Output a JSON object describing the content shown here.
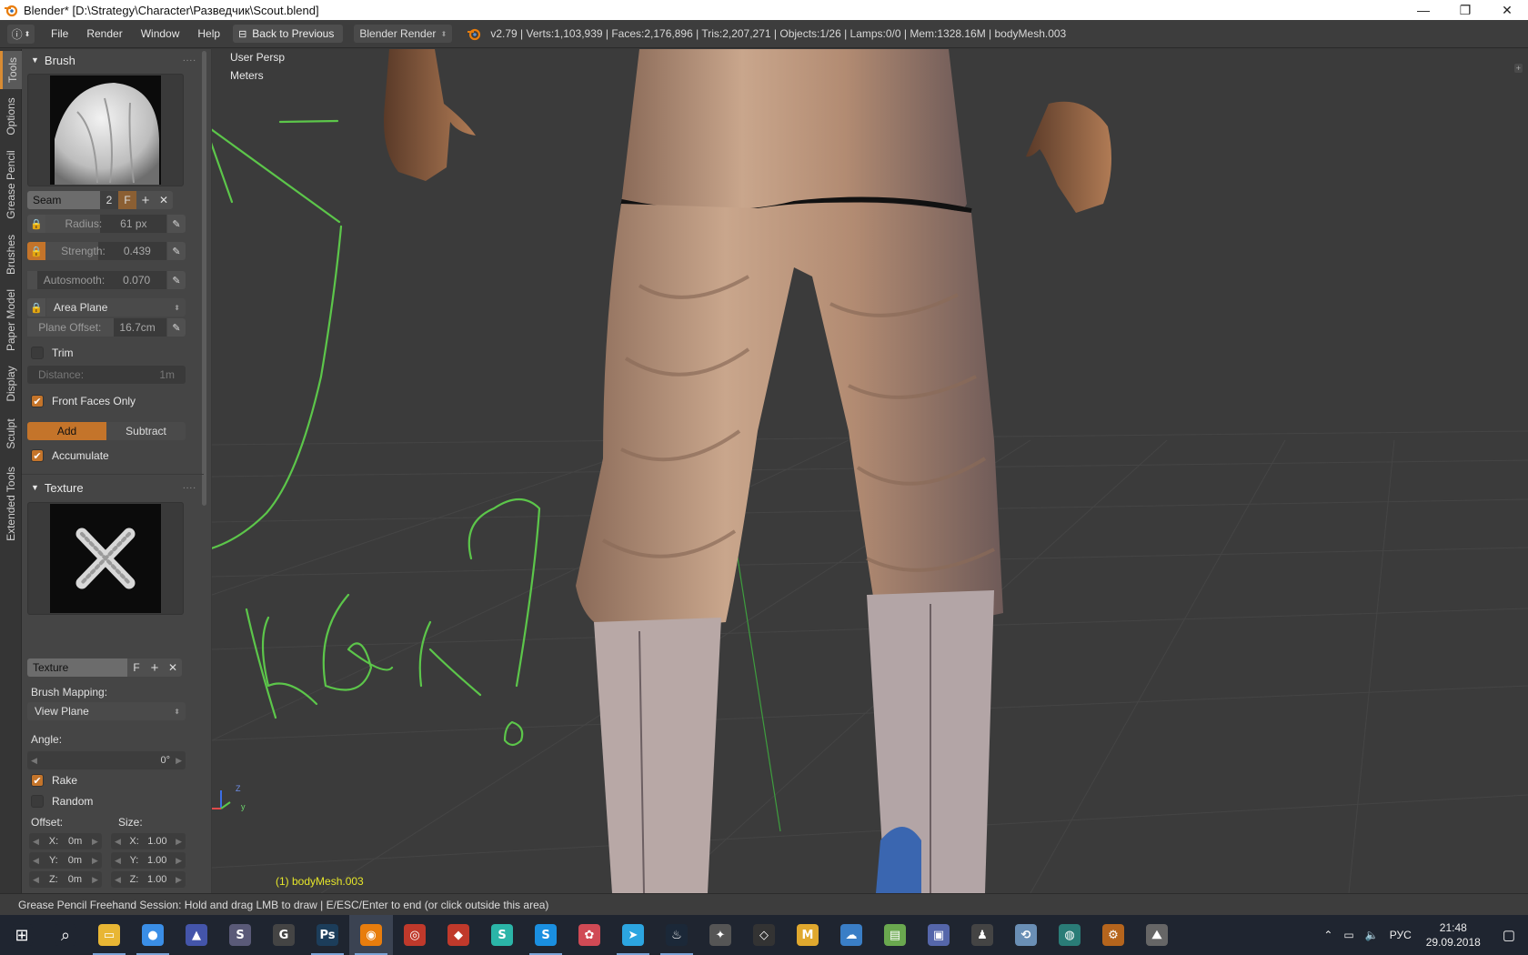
{
  "window": {
    "title": "Blender* [D:\\Strategy\\Character\\Разведчик\\Scout.blend]",
    "minimize_glyph": "—",
    "maximize_glyph": "❐",
    "close_glyph": "✕"
  },
  "header": {
    "menus": [
      "File",
      "Render",
      "Window",
      "Help"
    ],
    "back_button": "Back to Previous",
    "render_engine": "Blender Render",
    "version": "v2.79",
    "stats": "Verts:1,103,939 | Faces:2,176,896 | Tris:2,207,271 | Objects:1/26 | Lamps:0/0 | Mem:1328.16M | bodyMesh.003"
  },
  "tabs": [
    "Tools",
    "Options",
    "Grease Pencil",
    "Brushes",
    "Paper Model",
    "Display",
    "Sculpt",
    "Extended Tools"
  ],
  "brush_panel": {
    "title": "Brush",
    "brush_name": "Seam",
    "users": "2",
    "fake_user": "F",
    "radius_label": "Radius:",
    "radius_value": "61 px",
    "radius_fraction": 0.45,
    "strength_label": "Strength:",
    "strength_value": "0.439",
    "strength_fraction": 0.439,
    "autosmooth_label": "Autosmooth:",
    "autosmooth_value": "0.070",
    "autosmooth_fraction": 0.07,
    "area_mode": "Area Plane",
    "plane_offset_label": "Plane Offset:",
    "plane_offset_value": "16.7cm",
    "plane_offset_fraction": 0.62,
    "trim_label": "Trim",
    "trim_checked": false,
    "distance_label": "Distance:",
    "distance_value": "1m",
    "front_faces_label": "Front Faces Only",
    "front_faces_checked": true,
    "add_label": "Add",
    "subtract_label": "Subtract",
    "accumulate_label": "Accumulate",
    "accumulate_checked": true
  },
  "texture_panel": {
    "title": "Texture",
    "texture_name": "Texture",
    "fake_user": "F",
    "brush_mapping_label": "Brush Mapping:",
    "brush_mapping_value": "View Plane",
    "angle_label": "Angle:",
    "angle_value": "0°",
    "rake_label": "Rake",
    "rake_checked": true,
    "random_label": "Random",
    "random_checked": false,
    "offset_label": "Offset:",
    "size_label": "Size:",
    "offset": [
      {
        "axis": "X:",
        "value": "0m"
      },
      {
        "axis": "Y:",
        "value": "0m"
      },
      {
        "axis": "Z:",
        "value": "0m"
      }
    ],
    "size": [
      {
        "axis": "X:",
        "value": "1.00"
      },
      {
        "axis": "Y:",
        "value": "1.00"
      },
      {
        "axis": "Z:",
        "value": "1.00"
      }
    ]
  },
  "viewport": {
    "view_name": "User Persp",
    "units": "Meters",
    "object_label": "(1) bodyMesh.003",
    "axis_z": "Z",
    "axis_y": "y",
    "annotation_color": "#5cc64a"
  },
  "status": {
    "text": "Grease Pencil Freehand Session: Hold and drag LMB to draw | E/ESC/Enter to end  (or click outside this area)"
  },
  "taskbar": {
    "apps": [
      {
        "name": "start",
        "glyph": "⊞",
        "color": "#1f2530"
      },
      {
        "name": "search",
        "glyph": "⌕",
        "color": "#1f2530"
      },
      {
        "name": "file-explorer",
        "glyph": "▭",
        "color": "#e8b634"
      },
      {
        "name": "chrome",
        "glyph": "●",
        "color": "#3a8ee6"
      },
      {
        "name": "app-4",
        "glyph": "▲",
        "color": "#4455aa"
      },
      {
        "name": "app-5",
        "glyph": "S",
        "color": "#5a5a78"
      },
      {
        "name": "gzdb",
        "glyph": "G",
        "color": "#444444"
      },
      {
        "name": "photoshop",
        "glyph": "Ps",
        "color": "#1c3d5a"
      },
      {
        "name": "blender",
        "glyph": "◉",
        "color": "#e87d0d"
      },
      {
        "name": "app-9",
        "glyph": "◎",
        "color": "#c0392b"
      },
      {
        "name": "app-10",
        "glyph": "◆",
        "color": "#c0392b"
      },
      {
        "name": "app-11",
        "glyph": "S",
        "color": "#2bb5a8"
      },
      {
        "name": "skype",
        "glyph": "S",
        "color": "#1a8fe0"
      },
      {
        "name": "app-13",
        "glyph": "✿",
        "color": "#d04a55"
      },
      {
        "name": "telegram",
        "glyph": "➤",
        "color": "#2ca5e0"
      },
      {
        "name": "steam",
        "glyph": "♨",
        "color": "#1b2838"
      },
      {
        "name": "app-16",
        "glyph": "✦",
        "color": "#555555"
      },
      {
        "name": "unity",
        "glyph": "◇",
        "color": "#333333"
      },
      {
        "name": "app-18",
        "glyph": "M",
        "color": "#e0a82e"
      },
      {
        "name": "app-19",
        "glyph": "☁",
        "color": "#3a7ec6"
      },
      {
        "name": "app-20",
        "glyph": "▤",
        "color": "#6aa84f"
      },
      {
        "name": "app-21",
        "glyph": "▣",
        "color": "#5566aa"
      },
      {
        "name": "app-22",
        "glyph": "♟",
        "color": "#444444"
      },
      {
        "name": "app-23",
        "glyph": "⟲",
        "color": "#6a8fb5"
      },
      {
        "name": "app-24",
        "glyph": "◍",
        "color": "#2a7c77"
      },
      {
        "name": "app-25",
        "glyph": "⚙",
        "color": "#b5651d"
      },
      {
        "name": "app-26",
        "glyph": "⛰",
        "color": "#666666"
      }
    ],
    "language": "РУС",
    "time": "21:48",
    "date": "29.09.2018"
  }
}
